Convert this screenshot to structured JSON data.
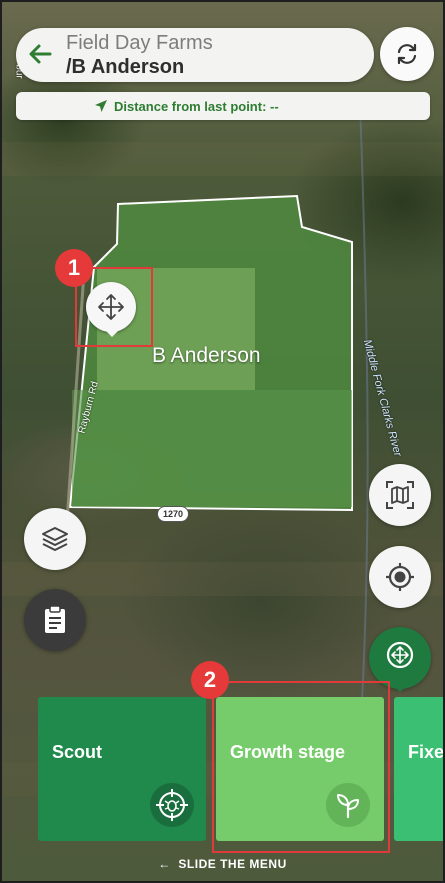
{
  "header": {
    "farm_name": "Field Day Farms",
    "field_name": "/B Anderson"
  },
  "distance": {
    "text": "Distance from last point: --"
  },
  "map": {
    "field_label": "B Anderson",
    "road_label": "Rayburn Rd",
    "river_label": "Middle Fork Clarks River",
    "route_shield": "1270",
    "edge_road_label": "bur"
  },
  "callouts": {
    "first": "1",
    "second": "2"
  },
  "menu": {
    "cards": [
      {
        "label": "Scout",
        "icon": "scout-target-icon",
        "color": "#1f8a4c"
      },
      {
        "label": "Growth stage",
        "icon": "sprout-icon",
        "color": "#76cc6a"
      },
      {
        "label": "Fixe",
        "icon": "",
        "color": "#3bbf72"
      }
    ],
    "slide_hint": "SLIDE THE MENU"
  },
  "icons": {
    "back": "arrow-left-icon",
    "refresh": "refresh-icon",
    "navigation": "navigation-arrow-icon",
    "layers": "layers-icon",
    "notes": "clipboard-icon",
    "map_view": "map-view-icon",
    "gps": "gps-target-icon",
    "move": "move-icon",
    "pin_move": "pin-move-icon"
  },
  "colors": {
    "accent": "#2e7d32",
    "callout": "#e03a3a"
  }
}
